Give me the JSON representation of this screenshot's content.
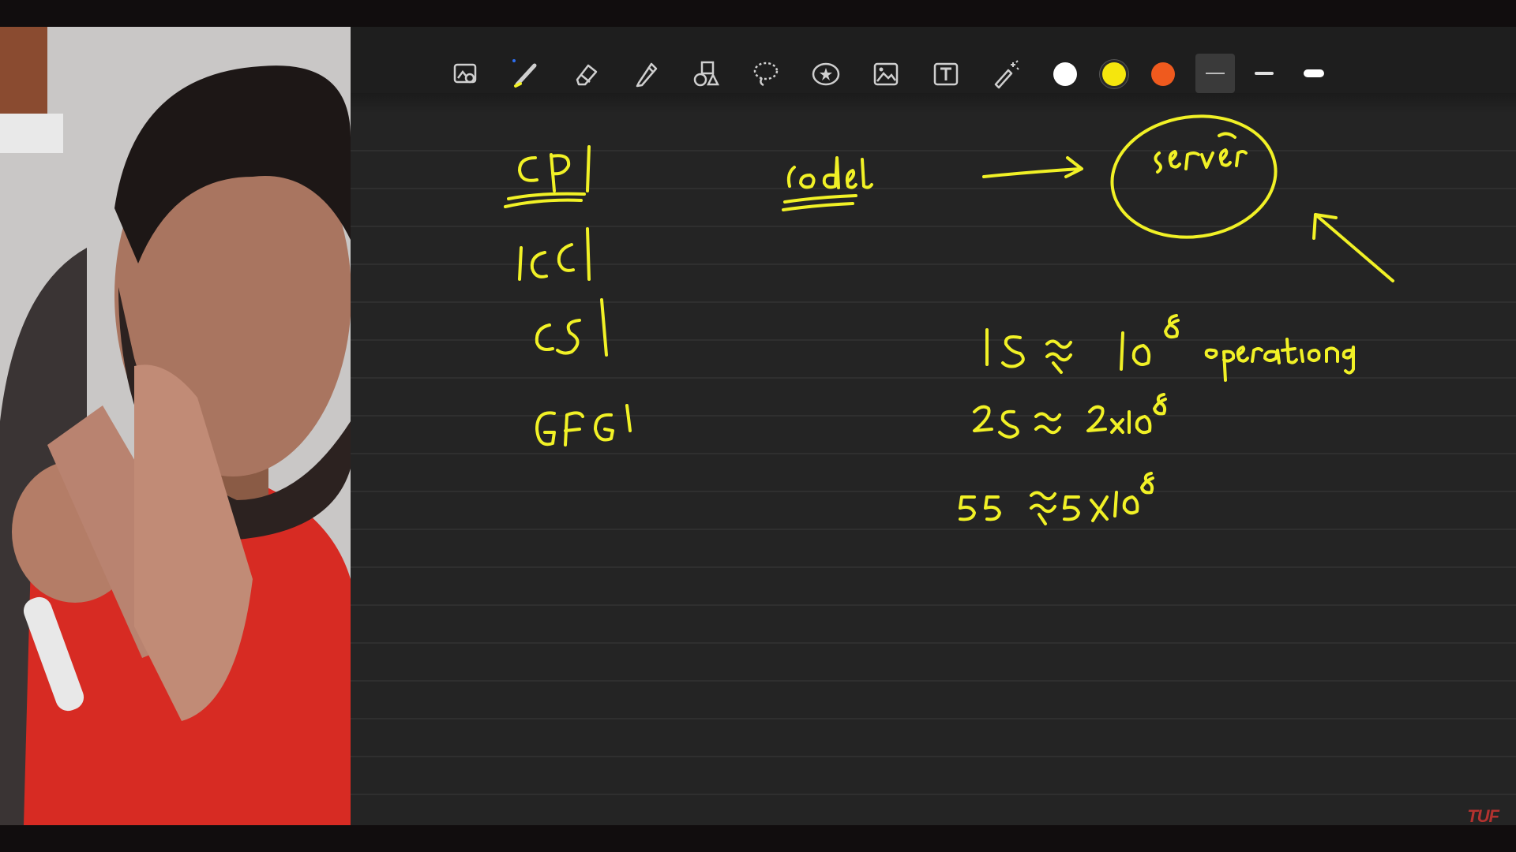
{
  "toolbar": {
    "tools": [
      {
        "name": "lasso-image-tool-icon"
      },
      {
        "name": "pen-tool-icon"
      },
      {
        "name": "eraser-tool-icon"
      },
      {
        "name": "highlighter-tool-icon"
      },
      {
        "name": "shapes-tool-icon"
      },
      {
        "name": "lasso-tool-icon"
      },
      {
        "name": "stickers-tool-icon"
      },
      {
        "name": "image-tool-icon"
      },
      {
        "name": "text-tool-icon"
      },
      {
        "name": "laser-pointer-icon"
      }
    ],
    "colors": [
      "#ffffff",
      "#f5e60d",
      "#ef5a1e"
    ],
    "stroke_options": [
      "thin",
      "medium",
      "thick"
    ],
    "selected_stroke": "thin"
  },
  "watermark": "TUF",
  "colors": {
    "ink": "#f1f126",
    "board": "#242424",
    "toolbar": "#1e1e1e"
  }
}
